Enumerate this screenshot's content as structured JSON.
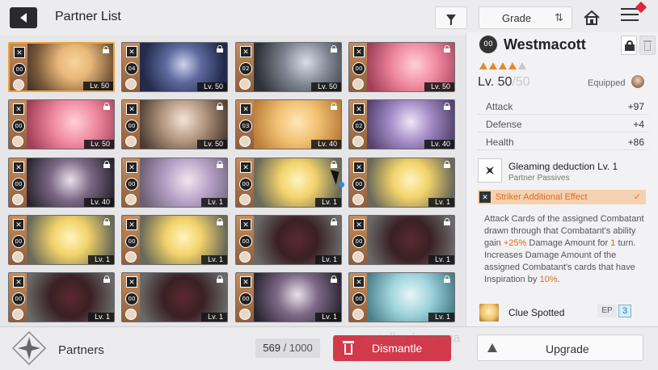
{
  "header": {
    "title": "Partner List",
    "grade_label": "Grade"
  },
  "cards": [
    {
      "rank": "00",
      "level": "Lv. 50",
      "art": "a",
      "selected": true
    },
    {
      "rank": "04",
      "level": "Lv. 50",
      "art": "b"
    },
    {
      "rank": "02",
      "level": "Lv. 50",
      "art": "c"
    },
    {
      "rank": "00",
      "level": "Lv. 50",
      "art": "d"
    },
    {
      "rank": "00",
      "level": "Lv. 50",
      "art": "d"
    },
    {
      "rank": "00",
      "level": "Lv. 50",
      "art": "e"
    },
    {
      "rank": "03",
      "level": "Lv. 40",
      "art": "f"
    },
    {
      "rank": "02",
      "level": "Lv. 40",
      "art": "g"
    },
    {
      "rank": "00",
      "level": "Lv. 40",
      "art": "h"
    },
    {
      "rank": "00",
      "level": "Lv. 1",
      "art": "i"
    },
    {
      "rank": "00",
      "level": "Lv. 1",
      "art": "j"
    },
    {
      "rank": "00",
      "level": "Lv. 1",
      "art": "j"
    },
    {
      "rank": "00",
      "level": "Lv. 1",
      "art": "j"
    },
    {
      "rank": "00",
      "level": "Lv. 1",
      "art": "j"
    },
    {
      "rank": "00",
      "level": "Lv. 1",
      "art": "k"
    },
    {
      "rank": "00",
      "level": "Lv. 1",
      "art": "k"
    },
    {
      "rank": "00",
      "level": "Lv. 1",
      "art": "k"
    },
    {
      "rank": "00",
      "level": "Lv. 1",
      "art": "k"
    },
    {
      "rank": "00",
      "level": "Lv. 1",
      "art": "h"
    },
    {
      "rank": "00",
      "level": "Lv. 1",
      "art": "l"
    }
  ],
  "detail": {
    "rank": "00",
    "name": "Westmacott",
    "stars_filled": 4,
    "stars_total": 5,
    "level": "Lv. 50",
    "level_max": "/50",
    "equipped_label": "Equipped",
    "stats": [
      {
        "key": "Attack",
        "value": "+97"
      },
      {
        "key": "Defense",
        "value": "+4"
      },
      {
        "key": "Health",
        "value": "+86"
      }
    ],
    "passive_name": "Gleaming deduction Lv. 1",
    "passive_sub": "Partner Passives",
    "striker_label": "Striker Additional Effect",
    "desc_parts": [
      "Attack Cards of the assigned Combatant drawn through that Combatant's ability gain ",
      "+25%",
      " Damage Amount for ",
      "1",
      " turn. Increases Damage Amount of the assigned Combatant's cards that have Inspiration by ",
      "10%",
      "."
    ],
    "clue_name": "Clue Spotted",
    "ep_label": "EP",
    "ep_value": "3"
  },
  "bottom": {
    "partners_label": "Partners",
    "count_current": "569",
    "count_total": " / 1000",
    "dismantle_label": "Dismantle",
    "upgrade_label": "Upgrade",
    "watermark": "mseller / waraga"
  },
  "colors": {
    "accent_orange": "#e38a2e",
    "dismantle_red": "#d23a4b",
    "selected_border": "#e9a43a"
  }
}
